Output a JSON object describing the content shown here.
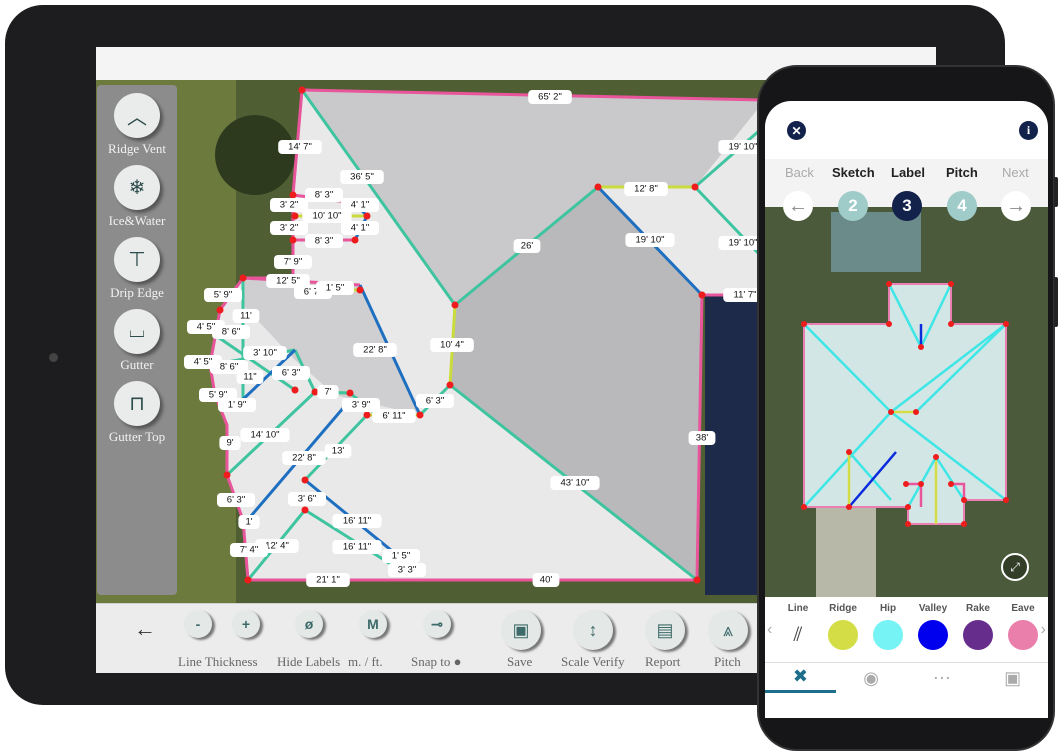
{
  "tablet": {
    "left_panel": [
      {
        "label": "Ridge Vent",
        "icon": "ridge-vent-icon"
      },
      {
        "label": "Ice&Water",
        "icon": "snowflake-icon"
      },
      {
        "label": "Drip Edge",
        "icon": "drip-edge-icon"
      },
      {
        "label": "Gutter",
        "icon": "gutter-icon"
      },
      {
        "label": "Gutter Top",
        "icon": "gutter-top-icon"
      }
    ],
    "toolbar": {
      "back": "←",
      "minus": "-",
      "plus": "+",
      "hide_icon": "ø",
      "m_icon": "M",
      "line_thickness": "Line Thickness",
      "hide_labels": "Hide Labels",
      "units": "m. / ft.",
      "snap_to": "Snap to ●",
      "save": "Save",
      "scale_verify": "Scale Verify",
      "report": "Report",
      "pitch": "Pitch"
    },
    "measurements": [
      "65' 2\"",
      "14' 7\"",
      "36' 5\"",
      "19' 10\"",
      "12' 8\"",
      "8' 3\"",
      "3' 2\"",
      "4' 1\"",
      "10' 10\"",
      "3' 2\"",
      "4' 1\"",
      "8' 3\"",
      "19' 10\"",
      "26'",
      "19' 10\"",
      "7' 9\"",
      "12' 5\"",
      "6' 7\"",
      "1' 5\"",
      "11' 7\"",
      "5' 9\"",
      "11'",
      "4' 5\"",
      "8' 6\"",
      "10' 4\"",
      "22' 8\"",
      "3' 10\"",
      "4' 5\"",
      "8' 6\"",
      "6' 3\"",
      "11\"",
      "7'",
      "5' 9\"",
      "1' 9\"",
      "3' 9\"",
      "6' 3\"",
      "6' 11\"",
      "14' 10\"",
      "38'",
      "9'",
      "13'",
      "22' 8\"",
      "43' 10\"",
      "6' 3\"",
      "3' 6\"",
      "1'",
      "16' 11\"",
      "12' 4\"",
      "16' 11\"",
      "7' 4\"",
      "1' 5\"",
      "3' 3\"",
      "21' 1\"",
      "40'"
    ]
  },
  "phone": {
    "close": "✕",
    "info": "i",
    "steps": {
      "back": "Back",
      "sketch": "Sketch",
      "label": "Label",
      "pitch": "Pitch",
      "next": "Next"
    },
    "step_numbers": {
      "sketch": "2",
      "label": "3",
      "pitch": "4"
    },
    "current_step": "3",
    "palette": [
      {
        "label": "Line",
        "color": ""
      },
      {
        "label": "Ridge",
        "color": "#d4dd45"
      },
      {
        "label": "Hip",
        "color": "#76f3f5"
      },
      {
        "label": "Valley",
        "color": "#0000ee"
      },
      {
        "label": "Rake",
        "color": "#672d8c"
      },
      {
        "label": "Eave",
        "color": "#ea7fab"
      }
    ],
    "tabs": [
      {
        "icon": "tools-icon",
        "active": true
      },
      {
        "icon": "eye-icon",
        "active": false
      },
      {
        "icon": "more-icon",
        "active": false
      },
      {
        "icon": "save-icon",
        "active": false
      }
    ]
  },
  "colors": {
    "hip": "#3fc4a0",
    "valley": "#1f6fc0",
    "ridge": "#c9dc3c",
    "eave": "#e8559a",
    "vertex": "#ee1c1c"
  }
}
